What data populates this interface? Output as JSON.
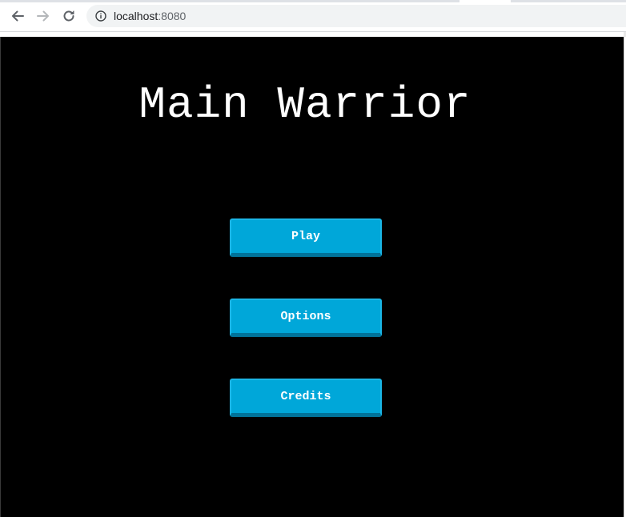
{
  "browser": {
    "url_host": "localhost",
    "url_port": ":8080",
    "icons": {
      "back": "arrow-left-icon",
      "forward": "arrow-right-icon",
      "reload": "reload-icon",
      "site_info": "info-icon"
    }
  },
  "game": {
    "title": "Main Warrior",
    "menu": {
      "play_label": "Play",
      "options_label": "Options",
      "credits_label": "Credits"
    },
    "colors": {
      "background": "#000000",
      "button": "#00a7d9",
      "button_shadow": "#00739a",
      "text": "#ffffff"
    }
  }
}
